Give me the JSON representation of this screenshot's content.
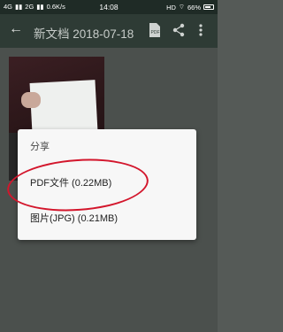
{
  "status_bar": {
    "left": [
      "4G",
      "2G",
      "0.6K/s"
    ],
    "time": "14:08",
    "right": [
      "HD",
      "66%"
    ]
  },
  "toolbar": {
    "back_icon": "arrow-left-icon",
    "title": "新文档 2018-07-18",
    "icons": [
      "pdf-file-icon",
      "share-icon",
      "more-vertical-icon"
    ]
  },
  "dialog": {
    "title": "分享",
    "items": [
      {
        "label": "PDF文件 (0.22MB)"
      },
      {
        "label": "图片(JPG) (0.21MB)"
      }
    ]
  },
  "colors": {
    "toolbar": "#2e3b35",
    "status_bar": "#1f2b26",
    "highlight": "#d3162c"
  }
}
